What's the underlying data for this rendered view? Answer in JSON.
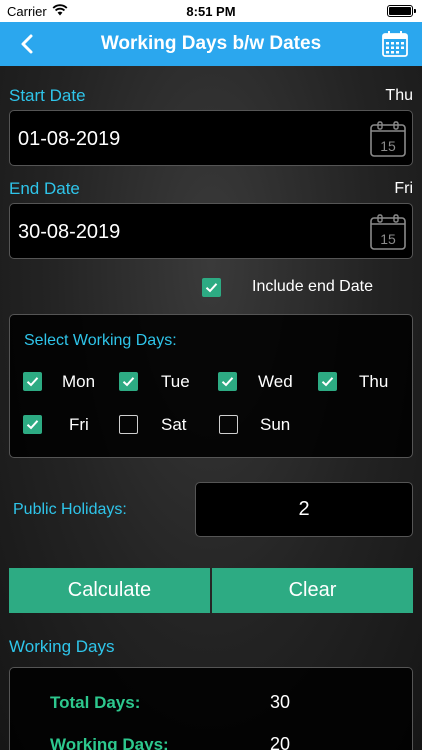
{
  "status_bar": {
    "carrier": "Carrier",
    "time": "8:51 PM"
  },
  "nav": {
    "title": "Working Days b/w Dates",
    "back_icon": "chevron-left-icon",
    "calendar_icon": "calendar-icon"
  },
  "start": {
    "label": "Start Date",
    "weekday": "Thu",
    "value": "01-08-2019",
    "calendar_day": "15"
  },
  "end": {
    "label": "End Date",
    "weekday": "Fri",
    "value": "30-08-2019",
    "calendar_day": "15"
  },
  "include_end": {
    "label": "Include end Date",
    "checked": true
  },
  "working_days_panel": {
    "title": "Select Working Days:",
    "days": [
      {
        "label": "Mon",
        "checked": true
      },
      {
        "label": "Tue",
        "checked": true
      },
      {
        "label": "Wed",
        "checked": true
      },
      {
        "label": "Thu",
        "checked": true
      },
      {
        "label": "Fri",
        "checked": true
      },
      {
        "label": "Sat",
        "checked": false
      },
      {
        "label": "Sun",
        "checked": false
      }
    ]
  },
  "public_holidays": {
    "label": "Public Holidays:",
    "value": "2"
  },
  "buttons": {
    "calculate": "Calculate",
    "clear": "Clear"
  },
  "result": {
    "title": "Working Days",
    "rows": [
      {
        "label": "Total Days:",
        "value": "30"
      },
      {
        "label": "Working Days:",
        "value": "20"
      }
    ]
  },
  "colors": {
    "accent_blue": "#2ba7ee",
    "label_cyan": "#2fc5ea",
    "button_green": "#2dab83",
    "result_green": "#2dc88e"
  }
}
